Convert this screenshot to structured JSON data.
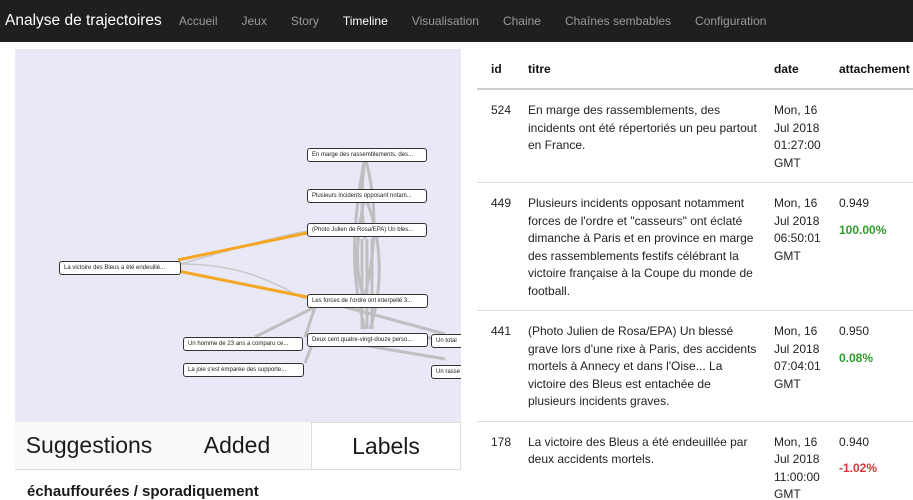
{
  "navbar": {
    "brand": "Analyse de trajectoires",
    "items": [
      {
        "label": "Accueil",
        "active": false
      },
      {
        "label": "Jeux",
        "active": false
      },
      {
        "label": "Story",
        "active": false
      },
      {
        "label": "Timeline",
        "active": true
      },
      {
        "label": "Visualisation",
        "active": false
      },
      {
        "label": "Chaine",
        "active": false
      },
      {
        "label": "Chaînes sembables",
        "active": false
      },
      {
        "label": "Configuration",
        "active": false
      }
    ]
  },
  "graph": {
    "nodes": [
      {
        "label": "En marge des rassemblements, des..."
      },
      {
        "label": "Plusieurs incidents opposant notam..."
      },
      {
        "label": "(Photo Julien de Rosa/EPA) Un bles..."
      },
      {
        "label": "La victoire des Bleus a été endeuillé..."
      },
      {
        "label": "Les forces de l'ordre ont interpellé 3..."
      },
      {
        "label": "Un homme de 23 ans a comparu ce..."
      },
      {
        "label": "Deux cent quatre-vingt-douze perso..."
      },
      {
        "label": "Un total"
      },
      {
        "label": "La joie s'est emparée des supporte..."
      },
      {
        "label": "Un rasse"
      }
    ]
  },
  "tabs": {
    "suggestions": "Suggestions",
    "added": "Added",
    "labels": "Labels"
  },
  "suggestion": {
    "title": "échauffourées / sporadiquement"
  },
  "table": {
    "headers": {
      "id": "id",
      "titre": "titre",
      "date": "date",
      "attachement": "attachement"
    },
    "rows": [
      {
        "id": "524",
        "titre": "En marge des rassemblements, des incidents ont été répertoriés un peu partout en France.",
        "date": "Mon, 16 Jul 2018 01:27:00 GMT",
        "score": "",
        "pct": ""
      },
      {
        "id": "449",
        "titre": "Plusieurs incidents opposant notamment forces de l'ordre et \"casseurs\" ont éclaté dimanche à Paris et en province en marge des rassemblements festifs célébrant la victoire française à la Coupe du monde de football.",
        "date": "Mon, 16 Jul 2018 06:50:01 GMT",
        "score": "0.949",
        "pct": "100.00%"
      },
      {
        "id": "441",
        "titre": "(Photo Julien de Rosa/EPA) Un blessé grave lors d'une rixe à Paris, des accidents mortels à Annecy et dans l'Oise... La victoire des Bleus est entachée de plusieurs incidents graves.",
        "date": "Mon, 16 Jul 2018 07:04:01 GMT",
        "score": "0.950",
        "pct": "0.08%"
      },
      {
        "id": "178",
        "titre": "La victoire des Bleus a été endeuillée par deux accidents mortels.",
        "date": "Mon, 16 Jul 2018 11:00:00 GMT",
        "score": "0.940",
        "pct": "-1.02%"
      }
    ]
  },
  "colors": {
    "navbar_bg": "#1f1f1f",
    "graph_bg": "#e8e8f6",
    "edge_highlight": "#f5a623",
    "edge_muted": "#b8b8b8",
    "positive": "#2e9b2e",
    "negative": "#d9343a"
  }
}
